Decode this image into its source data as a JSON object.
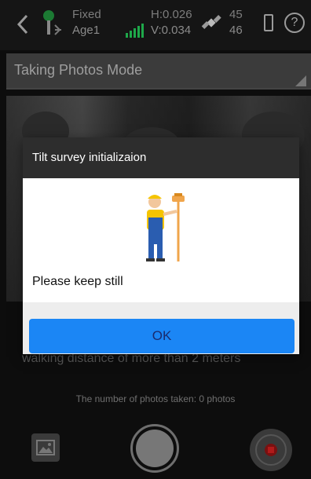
{
  "status": {
    "fix": "Fixed",
    "age": "Age1",
    "h_precision": "H:0.026",
    "v_precision": "V:0.034",
    "sat_a": "45",
    "sat_b": "46",
    "help": "?"
  },
  "mode": {
    "label": "Taking Photos Mode"
  },
  "instructions": {
    "text": "walking distance of more than 2 meters"
  },
  "photo_count": {
    "text": "The number of photos taken: 0 photos"
  },
  "dialog": {
    "title": "Tilt survey initializaion",
    "message": "Please keep still",
    "ok_label": "OK"
  },
  "colors": {
    "accent": "#1b86f5",
    "signal": "#1ea84a",
    "record": "#b01a1a"
  }
}
